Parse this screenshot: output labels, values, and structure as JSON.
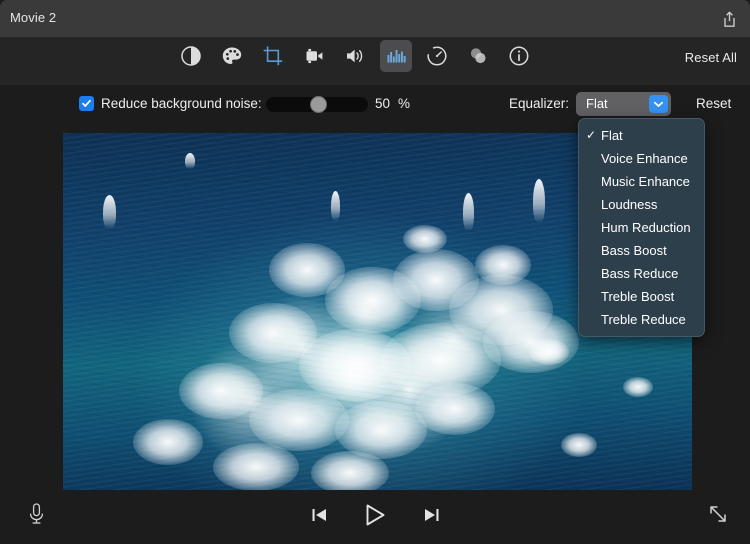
{
  "window": {
    "title": "Movie 2",
    "share_icon": "share-icon"
  },
  "toolbar": {
    "reset_all_label": "Reset All",
    "tools": [
      {
        "name": "adjust-exposure-icon",
        "label": "Adjust",
        "selected": false
      },
      {
        "name": "color-balance-icon",
        "label": "Color Balance",
        "selected": false
      },
      {
        "name": "crop-icon",
        "label": "Crop",
        "selected": false
      },
      {
        "name": "video-camera-icon",
        "label": "Video",
        "selected": false
      },
      {
        "name": "volume-icon",
        "label": "Volume",
        "selected": false
      },
      {
        "name": "equalizer-icon",
        "label": "Audio Equalizer",
        "selected": true
      },
      {
        "name": "speed-icon",
        "label": "Speed",
        "selected": false
      },
      {
        "name": "filters-icon",
        "label": "Filters",
        "selected": false
      },
      {
        "name": "info-icon",
        "label": "Info",
        "selected": false
      }
    ]
  },
  "controls": {
    "noise_checkbox_label": "Reduce background noise:",
    "noise_checkbox_checked": true,
    "noise_value": "50",
    "noise_percent_sign": "%",
    "noise_slider_percent": 50,
    "equalizer_label": "Equalizer:",
    "equalizer_value": "Flat",
    "chevron_icon": "chevron-down-icon",
    "reset_label": "Reset"
  },
  "equalizer_menu": {
    "open": true,
    "selected": "Flat",
    "check_glyph": "✓",
    "items": [
      "Flat",
      "Voice Enhance",
      "Music Enhance",
      "Loudness",
      "Hum Reduction",
      "Bass Boost",
      "Bass Reduce",
      "Treble Boost",
      "Treble Reduce"
    ]
  },
  "video": {
    "description": "Aerial ocean footage with white foam and splashes"
  },
  "playback": {
    "mic_icon": "microphone-icon",
    "skip_back_icon": "skip-to-start-icon",
    "play_icon": "play-icon",
    "skip_forward_icon": "skip-to-end-icon",
    "fullscreen_icon": "resize-diagonal-icon"
  },
  "colors": {
    "accent_blue": "#1a7ef1",
    "chevron_blue": "#3592f5",
    "titlebar": "#3a3a3a",
    "toolbar": "#252525",
    "background": "#1c1c1c",
    "menu_background": "#2e3f4c"
  }
}
